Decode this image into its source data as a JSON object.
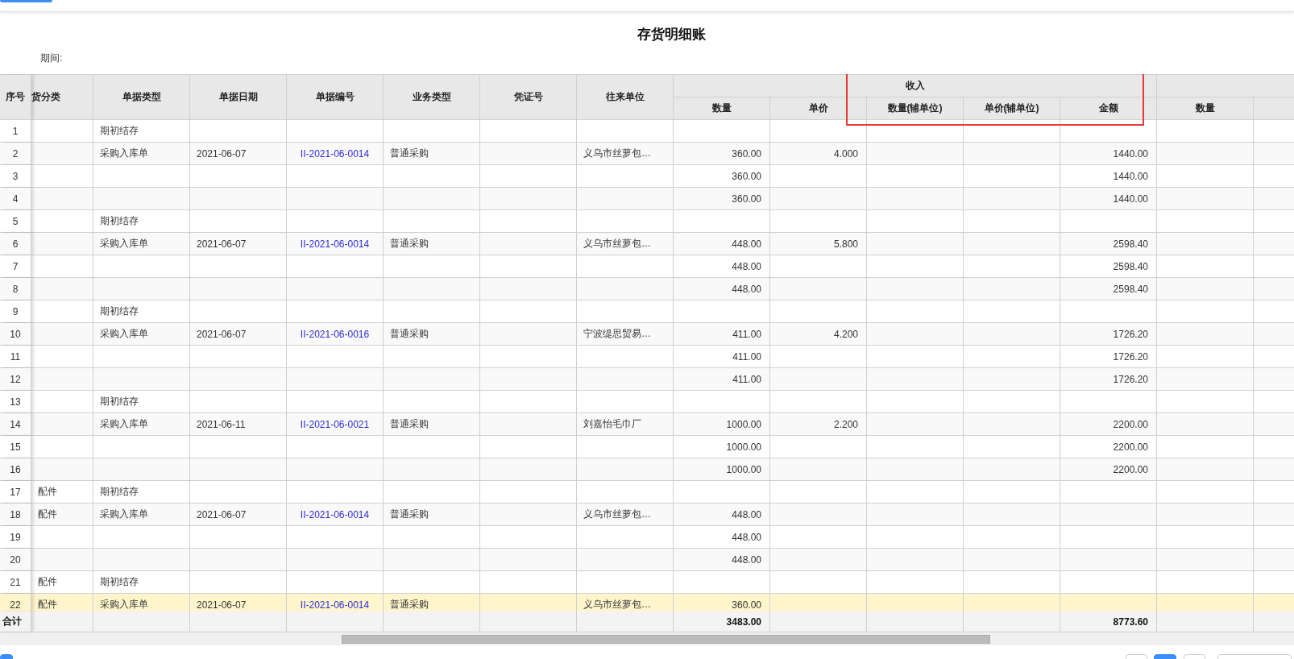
{
  "report": {
    "title": "存货明细账",
    "period_label": "期间:"
  },
  "table": {
    "fixed_columns": [
      {
        "label": "序号"
      },
      {
        "label": "货分类"
      },
      {
        "label": "单据类型"
      },
      {
        "label": "单据日期"
      },
      {
        "label": "单据编号"
      },
      {
        "label": "业务类型"
      },
      {
        "label": "凭证号"
      },
      {
        "label": "往来单位"
      }
    ],
    "groups": [
      {
        "label": "收入",
        "columns": [
          {
            "label": "数量"
          },
          {
            "label": "单价"
          },
          {
            "label": "数量(辅单位)"
          },
          {
            "label": "单价(辅单位)"
          },
          {
            "label": "金额"
          }
        ]
      },
      {
        "columns": [
          {
            "label": "数量"
          },
          {}
        ]
      }
    ],
    "rows": [
      {
        "seq": "1",
        "doc_type": "期初结存",
        "selected": false
      },
      {
        "seq": "2",
        "doc_type": "采购入库单",
        "date": "2021-06-07",
        "doc_no": "II-2021-06-0014",
        "biz_type": "普通采购",
        "partner": "义乌市丝萝包…",
        "qty": "360.00",
        "price": "4.000",
        "amount": "1440.00",
        "selected": false
      },
      {
        "seq": "3",
        "qty": "360.00",
        "amount": "1440.00",
        "selected": false
      },
      {
        "seq": "4",
        "qty": "360.00",
        "amount": "1440.00",
        "selected": false
      },
      {
        "seq": "5",
        "doc_type": "期初结存",
        "selected": false
      },
      {
        "seq": "6",
        "doc_type": "采购入库单",
        "date": "2021-06-07",
        "doc_no": "II-2021-06-0014",
        "biz_type": "普通采购",
        "partner": "义乌市丝萝包…",
        "qty": "448.00",
        "price": "5.800",
        "amount": "2598.40",
        "selected": false
      },
      {
        "seq": "7",
        "qty": "448.00",
        "amount": "2598.40",
        "selected": false
      },
      {
        "seq": "8",
        "qty": "448.00",
        "amount": "2598.40",
        "selected": false
      },
      {
        "seq": "9",
        "doc_type": "期初结存",
        "selected": false
      },
      {
        "seq": "10",
        "doc_type": "采购入库单",
        "date": "2021-06-07",
        "doc_no": "II-2021-06-0016",
        "biz_type": "普通采购",
        "partner": "宁波缇思贸易…",
        "qty": "411.00",
        "price": "4.200",
        "amount": "1726.20",
        "selected": false
      },
      {
        "seq": "11",
        "qty": "411.00",
        "amount": "1726.20",
        "selected": false
      },
      {
        "seq": "12",
        "qty": "411.00",
        "amount": "1726.20",
        "selected": false
      },
      {
        "seq": "13",
        "doc_type": "期初结存",
        "selected": false
      },
      {
        "seq": "14",
        "doc_type": "采购入库单",
        "date": "2021-06-11",
        "doc_no": "II-2021-06-0021",
        "biz_type": "普通采购",
        "partner": "刘嘉怡毛巾厂",
        "qty": "1000.00",
        "price": "2.200",
        "amount": "2200.00",
        "selected": false
      },
      {
        "seq": "15",
        "qty": "1000.00",
        "amount": "2200.00",
        "selected": false
      },
      {
        "seq": "16",
        "qty": "1000.00",
        "amount": "2200.00",
        "selected": false
      },
      {
        "seq": "17",
        "category": "配件",
        "doc_type": "期初结存",
        "selected": false
      },
      {
        "seq": "18",
        "category": "配件",
        "doc_type": "采购入库单",
        "date": "2021-06-07",
        "doc_no": "II-2021-06-0014",
        "biz_type": "普通采购",
        "partner": "义乌市丝萝包…",
        "qty": "448.00",
        "selected": false
      },
      {
        "seq": "19",
        "qty": "448.00",
        "selected": false
      },
      {
        "seq": "20",
        "qty": "448.00",
        "selected": false
      },
      {
        "seq": "21",
        "category": "配件",
        "doc_type": "期初结存",
        "selected": false
      },
      {
        "seq": "22",
        "category": "配件",
        "doc_type": "采购入库单",
        "date": "2021-06-07",
        "doc_no": "II-2021-06-0014",
        "biz_type": "普通采购",
        "partner": "义乌市丝萝包…",
        "qty": "360.00",
        "selected": true
      }
    ],
    "totals": {
      "label": "合计",
      "qty": "3483.00",
      "amount": "8773.60"
    }
  }
}
